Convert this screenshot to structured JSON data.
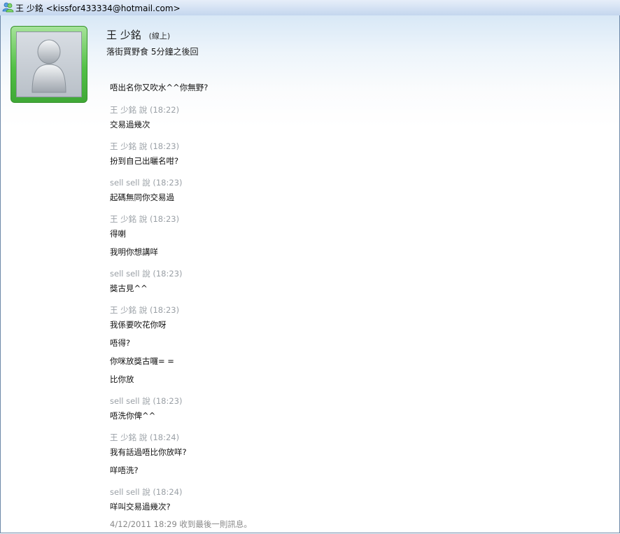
{
  "window": {
    "title": "王 少銘 <kissfor433334@hotmail.com>"
  },
  "contact": {
    "name": "王 少銘",
    "status": "(線上)",
    "personal_message": "落街買野食 5分鐘之後回"
  },
  "conversation": {
    "first_message": "唔出名你又吹水^^你無野?",
    "blocks": [
      {
        "sender": "王 少銘 說 (18:22)",
        "messages": [
          "交易過幾次"
        ]
      },
      {
        "sender": "王 少銘 說 (18:23)",
        "messages": [
          "扮到自己出曬名咁?"
        ]
      },
      {
        "sender": "sell sell 說 (18:23)",
        "messages": [
          "起碼無同你交易過"
        ]
      },
      {
        "sender": "王 少銘 說 (18:23)",
        "messages": [
          "得喇",
          "我明你想講咩"
        ]
      },
      {
        "sender": "sell sell 說 (18:23)",
        "messages": [
          "獎古見^^"
        ]
      },
      {
        "sender": "王 少銘 說 (18:23)",
        "messages": [
          "我係要吹花你呀",
          "唔得?",
          "你咪放獎古囉= =",
          "比你放"
        ]
      },
      {
        "sender": "sell sell 說 (18:23)",
        "messages": [
          "唔洗你俾^^"
        ]
      },
      {
        "sender": "王 少銘 說 (18:24)",
        "messages": [
          "我有話過唔比你放咩?",
          "咩唔洗?"
        ]
      },
      {
        "sender": "sell sell 說 (18:24)",
        "messages": [
          "咩叫交易過幾次?"
        ]
      }
    ],
    "footer": "4/12/2011 18:29 收到最後一則訊息。"
  }
}
